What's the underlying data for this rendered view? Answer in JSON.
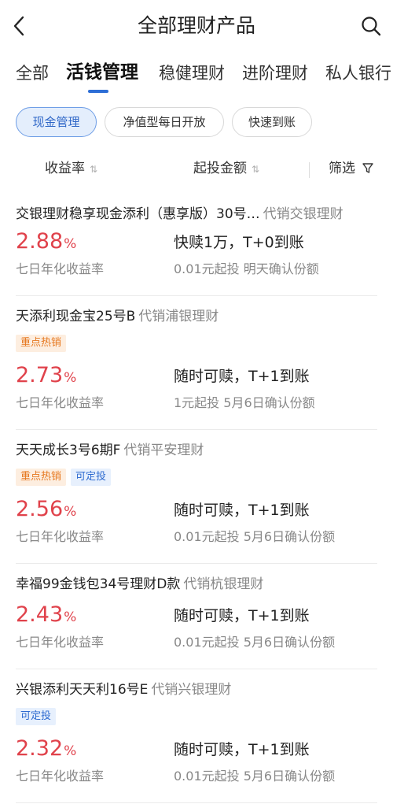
{
  "header": {
    "title": "全部理财产品"
  },
  "icons": {
    "back": "chevron-left-icon",
    "search": "search-icon",
    "sort": "sort-arrows-icon",
    "filter": "filter-icon"
  },
  "colors": {
    "accent": "#2d6ed6",
    "rate_red": "#e0424b",
    "hot_tag": "#e6781f",
    "fixed_tag": "#2e6bd0"
  },
  "tabs": [
    {
      "label": "全部"
    },
    {
      "label": "活钱管理",
      "active": true
    },
    {
      "label": "稳健理财"
    },
    {
      "label": "进阶理财"
    },
    {
      "label": "私人银行"
    }
  ],
  "chips": [
    {
      "label": "现金管理",
      "active": true
    },
    {
      "label": "净值型每日开放"
    },
    {
      "label": "快速到账"
    }
  ],
  "sort": {
    "yield_label": "收益率",
    "amount_label": "起投金额",
    "filter_label": "筛选"
  },
  "products": [
    {
      "name": "交银理财稳享现金添利（惠享版）30号…",
      "agency": "代销交银理财",
      "tags": [],
      "rate": "2.88",
      "rate_unit": "%",
      "rate_label": "七日年化收益率",
      "redeem": "快赎1万，T+0到账",
      "invest": "0.01元起投 明天确认份额"
    },
    {
      "name": "天添利现金宝25号B",
      "agency": "代销浦银理财",
      "tags": [
        {
          "label": "重点热销",
          "kind": "hot"
        }
      ],
      "rate": "2.73",
      "rate_unit": "%",
      "rate_label": "七日年化收益率",
      "redeem": "随时可赎，T+1到账",
      "invest": "1元起投 5月6日确认份额"
    },
    {
      "name": "天天成长3号6期F",
      "agency": "代销平安理财",
      "tags": [
        {
          "label": "重点热销",
          "kind": "hot"
        },
        {
          "label": "可定投",
          "kind": "fixed"
        }
      ],
      "rate": "2.56",
      "rate_unit": "%",
      "rate_label": "七日年化收益率",
      "redeem": "随时可赎，T+1到账",
      "invest": "0.01元起投 5月6日确认份额"
    },
    {
      "name": "幸福99金钱包34号理财D款",
      "agency": "代销杭银理财",
      "tags": [],
      "rate": "2.43",
      "rate_unit": "%",
      "rate_label": "七日年化收益率",
      "redeem": "随时可赎，T+1到账",
      "invest": "0.01元起投 5月6日确认份额"
    },
    {
      "name": "兴银添利天天利16号E",
      "agency": "代销兴银理财",
      "tags": [
        {
          "label": "可定投",
          "kind": "fixed"
        }
      ],
      "rate": "2.32",
      "rate_unit": "%",
      "rate_label": "七日年化收益率",
      "redeem": "随时可赎，T+1到账",
      "invest": "0.01元起投 5月6日确认份额"
    }
  ]
}
